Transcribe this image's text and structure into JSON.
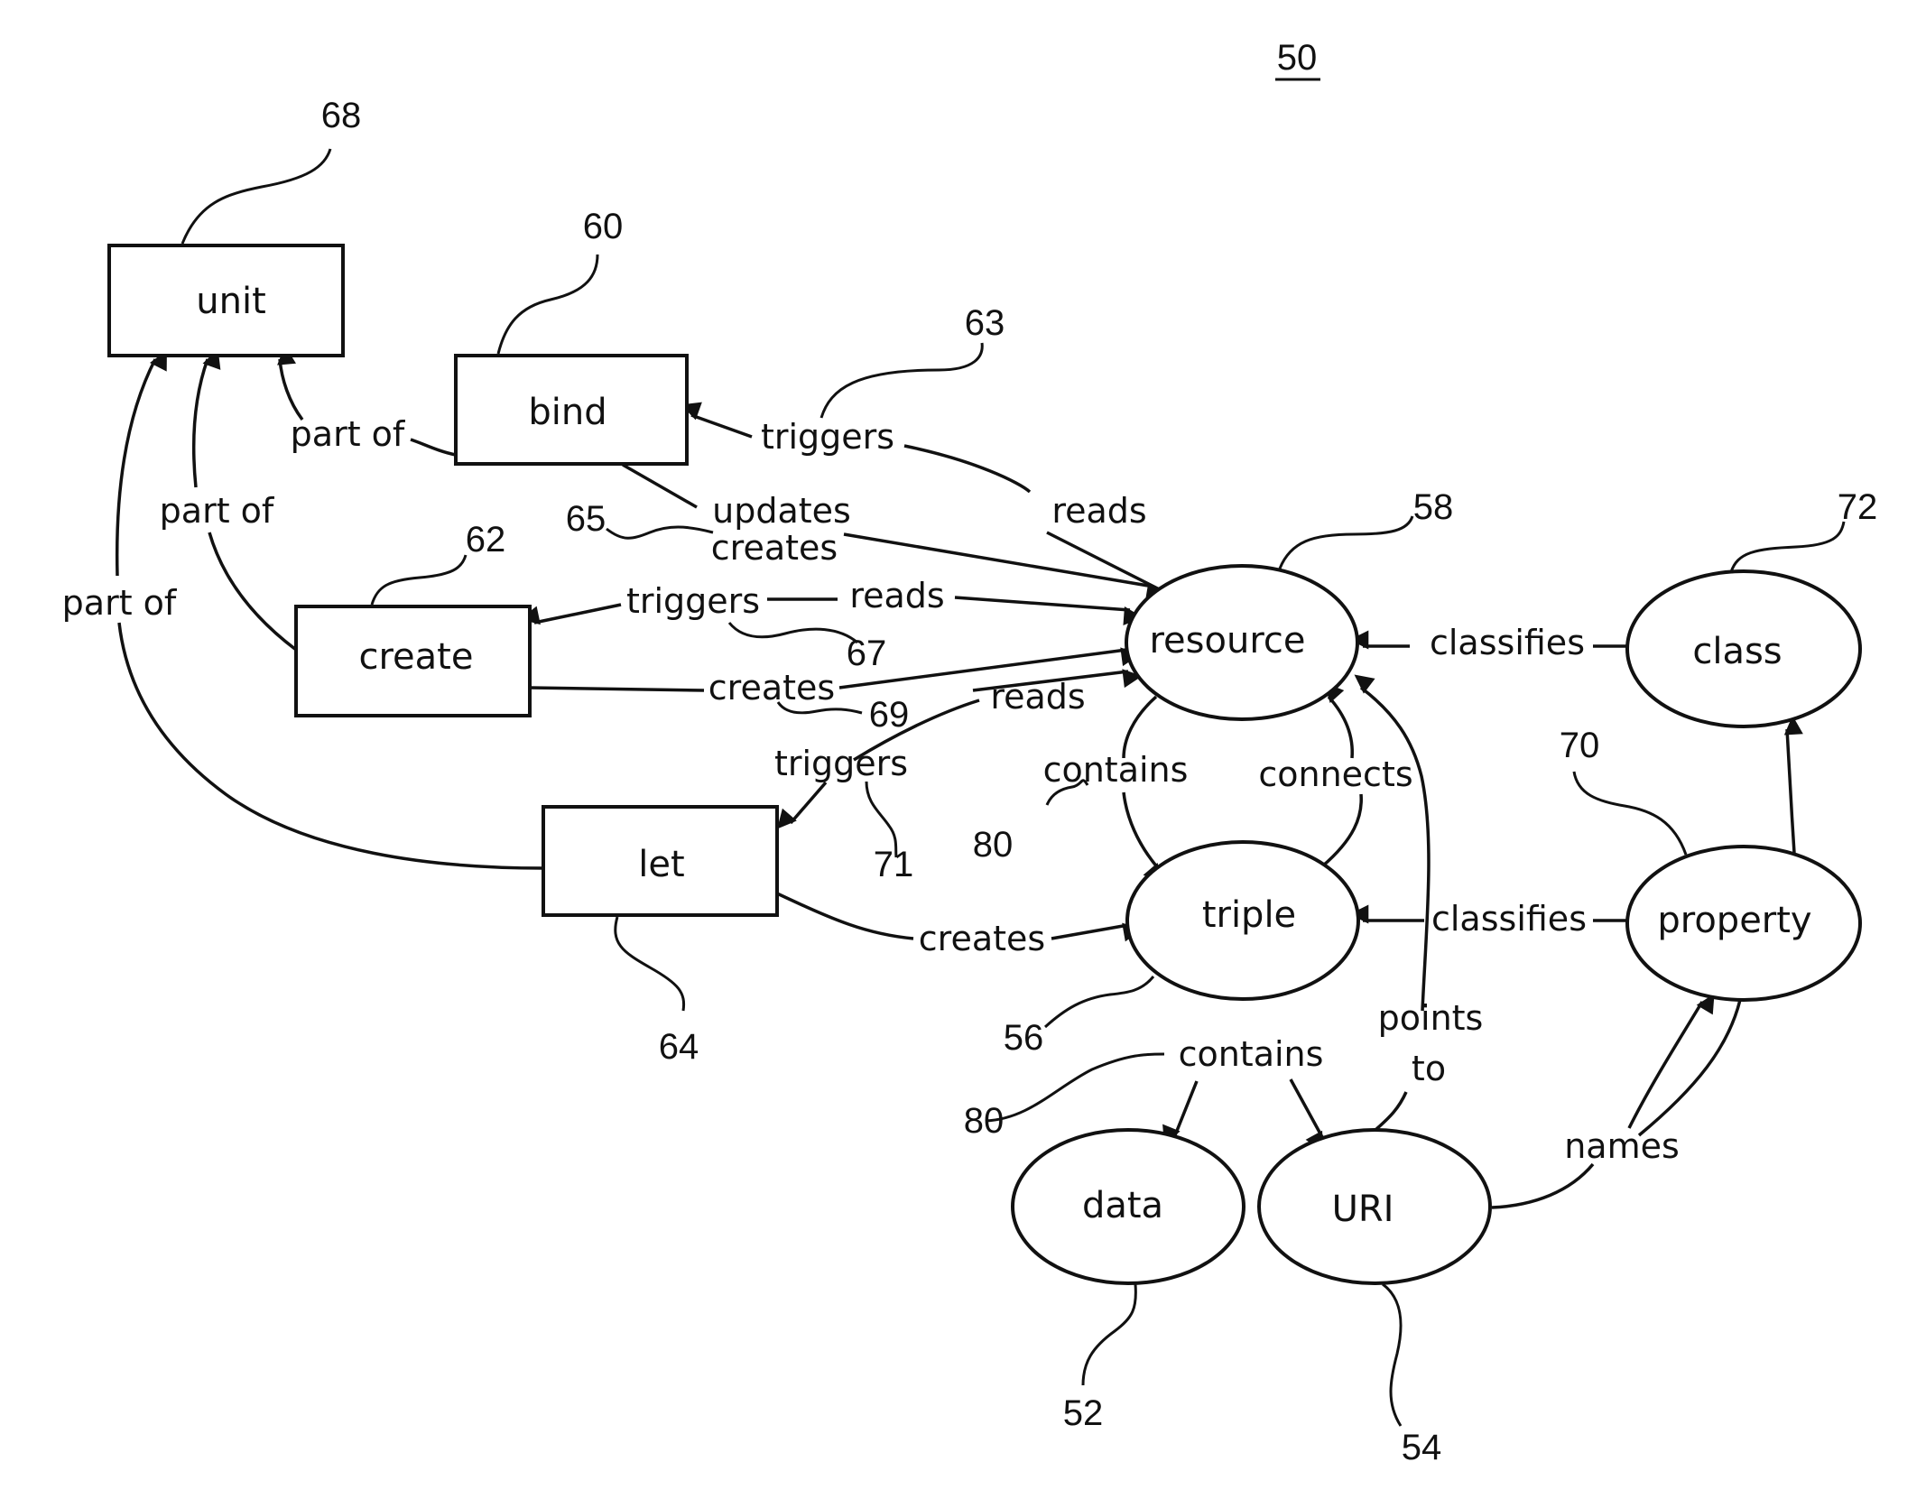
{
  "figure": {
    "number": "50"
  },
  "nodes": {
    "unit": {
      "label": "unit",
      "ref": "68",
      "shape": "rectangle"
    },
    "bind": {
      "label": "bind",
      "ref": "60",
      "shape": "rectangle"
    },
    "create": {
      "label": "create",
      "ref": "62",
      "shape": "rectangle"
    },
    "let": {
      "label": "let",
      "ref": "64",
      "shape": "rectangle"
    },
    "resource": {
      "label": "resource",
      "ref": "58",
      "shape": "ellipse"
    },
    "class": {
      "label": "class",
      "ref": "72",
      "shape": "ellipse"
    },
    "triple": {
      "label": "triple",
      "ref": "56",
      "shape": "ellipse"
    },
    "property": {
      "label": "property",
      "ref": "70",
      "shape": "ellipse"
    },
    "data": {
      "label": "data",
      "ref": "52",
      "shape": "ellipse"
    },
    "uri": {
      "label": "URI",
      "ref": "54",
      "shape": "ellipse"
    }
  },
  "edges": {
    "bind_part_of_unit": {
      "label": "part of",
      "from": "bind",
      "to": "unit"
    },
    "create_part_of_unit": {
      "label": "part of",
      "from": "create",
      "to": "unit"
    },
    "let_part_of_unit": {
      "label": "part of",
      "from": "let",
      "to": "unit"
    },
    "bind_triggers_reads": {
      "label_a": "triggers",
      "label_b": "reads",
      "ref": "63",
      "from": "resource",
      "to": "bind"
    },
    "bind_updates_creates": {
      "label_a": "updates",
      "label_b": "creates",
      "ref": "65",
      "from": "bind",
      "to": "resource"
    },
    "create_triggers_reads": {
      "label_a": "triggers",
      "label_b": "reads",
      "ref": "67",
      "from": "resource",
      "to": "create"
    },
    "create_creates": {
      "label": "creates",
      "ref": "69",
      "from": "create",
      "to": "resource"
    },
    "let_triggers_reads": {
      "label_a": "triggers",
      "label_b": "reads",
      "ref": "71",
      "from": "resource",
      "to": "let"
    },
    "let_creates": {
      "label": "creates",
      "from": "let",
      "to": "triple"
    },
    "resource_contains_triple": {
      "label": "contains",
      "ref": "80",
      "from": "resource",
      "to": "triple"
    },
    "triple_connects_resource": {
      "label": "connects",
      "from": "triple",
      "to": "resource"
    },
    "class_classifies_resource": {
      "label": "classifies",
      "from": "class",
      "to": "resource"
    },
    "property_classifies_triple": {
      "label": "classifies",
      "from": "property",
      "to": "triple"
    },
    "property_to_class": {
      "from": "property",
      "to": "class"
    },
    "triple_contains": {
      "label": "contains",
      "ref": "80",
      "from": "triple",
      "to": [
        "data",
        "URI"
      ]
    },
    "uri_points_to_resource": {
      "label_a": "points",
      "label_b": "to",
      "from": "URI",
      "to": "resource"
    },
    "uri_names_property": {
      "label": "names",
      "from": "URI",
      "to": "property"
    }
  }
}
